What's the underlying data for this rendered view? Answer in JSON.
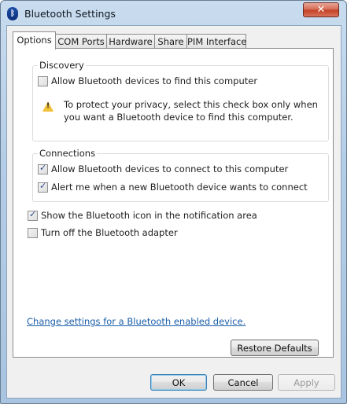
{
  "window": {
    "title": "Bluetooth Settings",
    "close_glyph": "✕",
    "icon_glyph": "ᛒ"
  },
  "tabs": [
    {
      "label": "Options",
      "active": true
    },
    {
      "label": "COM Ports",
      "active": false
    },
    {
      "label": "Hardware",
      "active": false
    },
    {
      "label": "Share",
      "active": false
    },
    {
      "label": "PIM Interface",
      "active": false
    }
  ],
  "discovery": {
    "label": "Discovery",
    "allow_find": {
      "label": "Allow Bluetooth devices to find this computer",
      "checked": false
    },
    "warning": {
      "line1": "To protect your privacy, select this check box only when",
      "line2": "you want a Bluetooth device to find this computer."
    }
  },
  "connections": {
    "label": "Connections",
    "allow_connect": {
      "label": "Allow Bluetooth devices to connect to this computer",
      "checked": true
    },
    "alert_new": {
      "label": "Alert me when a new Bluetooth device wants to connect",
      "checked": true
    }
  },
  "options": {
    "show_icon": {
      "label": "Show the Bluetooth icon in the notification area",
      "checked": true
    },
    "turn_off": {
      "label": "Turn off the Bluetooth adapter",
      "checked": false
    }
  },
  "link_text": "Change settings for a Bluetooth enabled device.",
  "buttons": {
    "restore_defaults": "Restore Defaults",
    "ok": "OK",
    "cancel": "Cancel",
    "apply": "Apply"
  }
}
